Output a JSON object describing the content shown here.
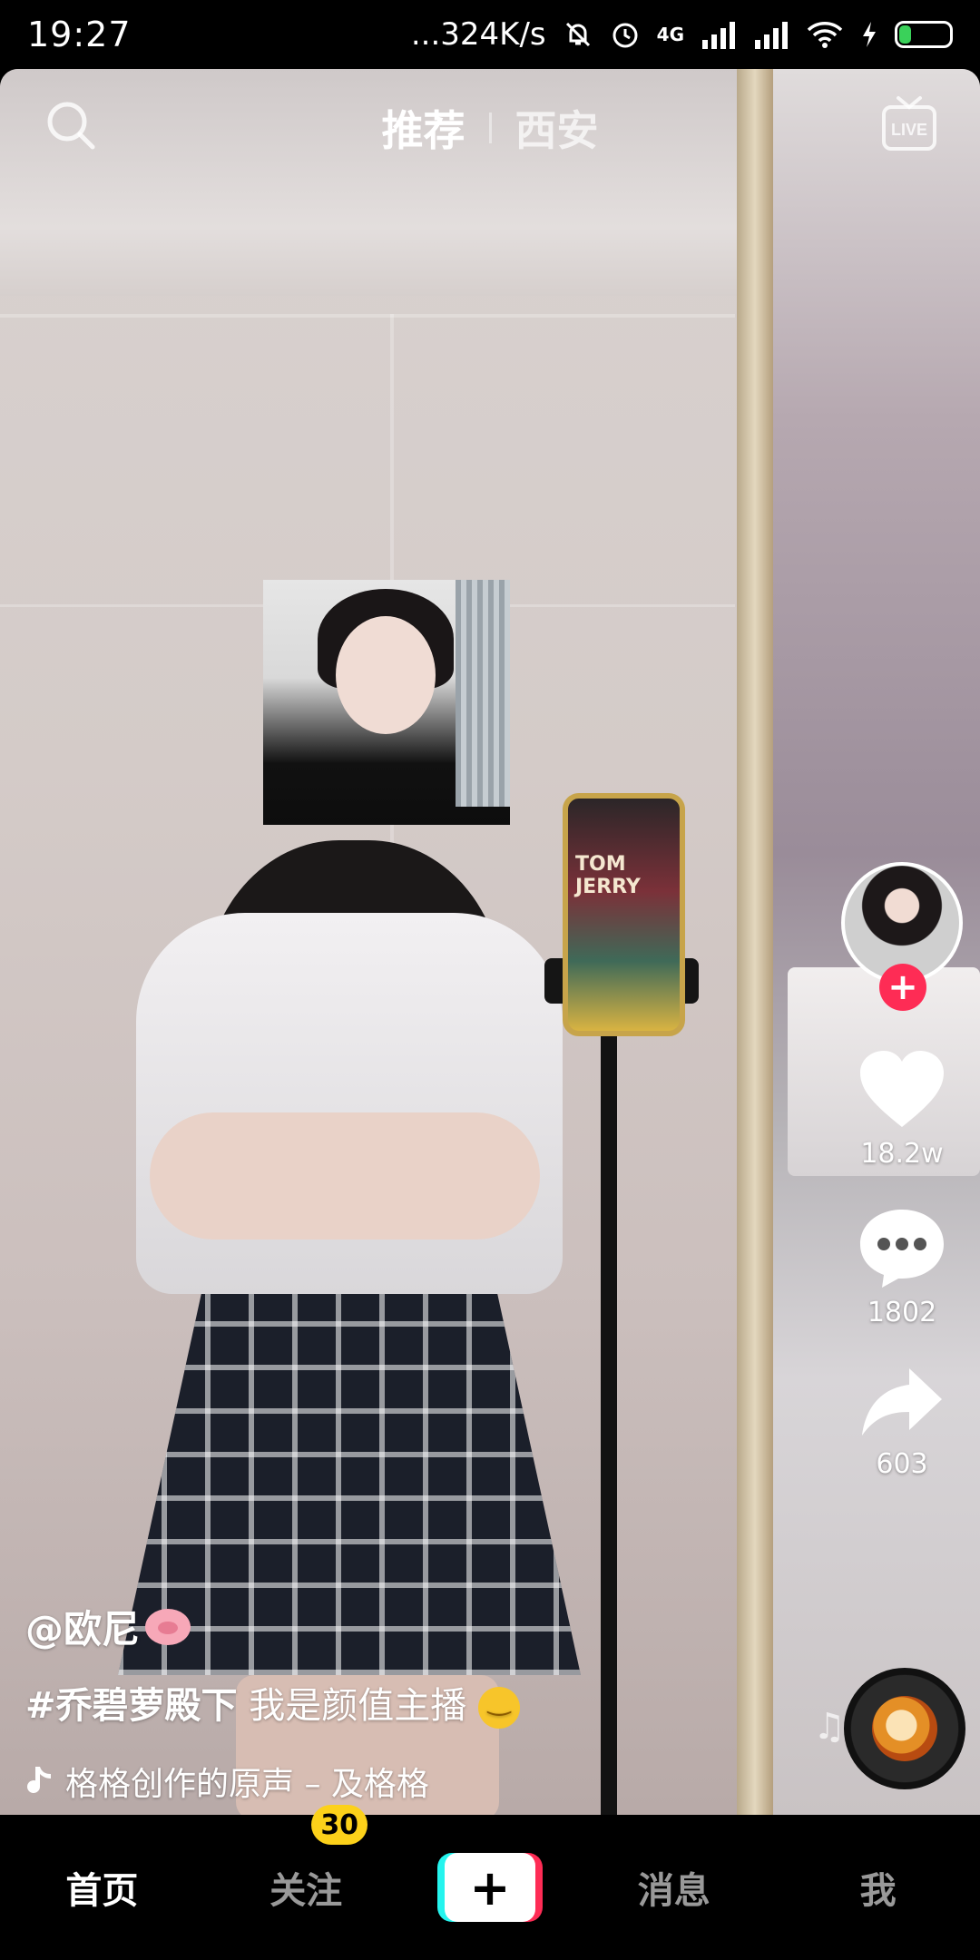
{
  "status_bar": {
    "time": "19:27",
    "net_speed": "...324K/s",
    "network": "4G",
    "battery": "23"
  },
  "top_tabs": {
    "tabs": [
      {
        "label": "推荐",
        "active": true
      },
      {
        "label": "西安",
        "active": false
      }
    ],
    "live_label": "LIVE"
  },
  "actions": {
    "likes": "18.2w",
    "comments": "1802",
    "shares": "603"
  },
  "caption": {
    "username": "@欧尼",
    "hashtag": "#乔碧萝殿下",
    "description": "我是颜值主播",
    "music": "格格创作的原声 – 及格格"
  },
  "bottom_nav": {
    "home": "首页",
    "follow": "关注",
    "follow_badge": "30",
    "create": "+",
    "messages": "消息",
    "me": "我"
  },
  "colors": {
    "accent_red": "#fe2c55",
    "accent_cyan": "#25f4ee",
    "badge_yellow": "#fcd11a"
  }
}
